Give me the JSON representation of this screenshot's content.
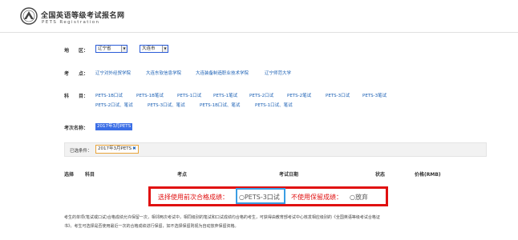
{
  "header": {
    "title_cn": "全国英语等级考试报名网",
    "title_en": "PETS Registration"
  },
  "region": {
    "label": "地　　区：",
    "province": "辽宁省",
    "city": "大连市"
  },
  "sites": {
    "label": "考　　点：",
    "items": [
      "辽宁对外经贸学院",
      "大连东软信息学院",
      "大连装备制造职业技术学院",
      "辽宁师范大学"
    ]
  },
  "subjects": {
    "label": "科　　目：",
    "row1": [
      "PETS-1B口试",
      "PETS-1B笔试",
      "PETS-1口试",
      "PETS-1笔试",
      "PETS-2口试",
      "PETS-2笔试",
      "PETS-3口试",
      "PETS-3笔试"
    ],
    "row2": [
      "PETS-2口试、笔试",
      "PETS-3口试、笔试",
      "PETS-1B口试、笔试",
      "PETS-1口试、笔试"
    ]
  },
  "session": {
    "label": "考次名称：",
    "value": "2017年3月PETS"
  },
  "conditions": {
    "label": "已选条件：",
    "tag": "2017年3月PETS",
    "remove_icon": "close-icon"
  },
  "table": {
    "headers": [
      "选择",
      "科目",
      "考点",
      "考试日期",
      "状态",
      "价格(RMB)"
    ]
  },
  "highlight": {
    "prefix": "选择使用前次合格成绩：",
    "option": "○PETS-3口试",
    "mid": "不使用保留成绩：",
    "abandon": "○放弃",
    "colors": {
      "box": "#e01010",
      "option_box": "#3a9ee4"
    }
  },
  "note": {
    "line1": "考生的单项(笔试或口试)合格成绩允许保留一次，相邻两次考试中，相同级别的笔试和口试成绩均合格的考生，可获得由教育部考试中心核发相应级别的《全国英语等级考试合格证",
    "line2": "书》。考生可选择是否使用最近一次的合格成绩进行保留，如不选择保留则视为自动放弃保留资格。"
  }
}
